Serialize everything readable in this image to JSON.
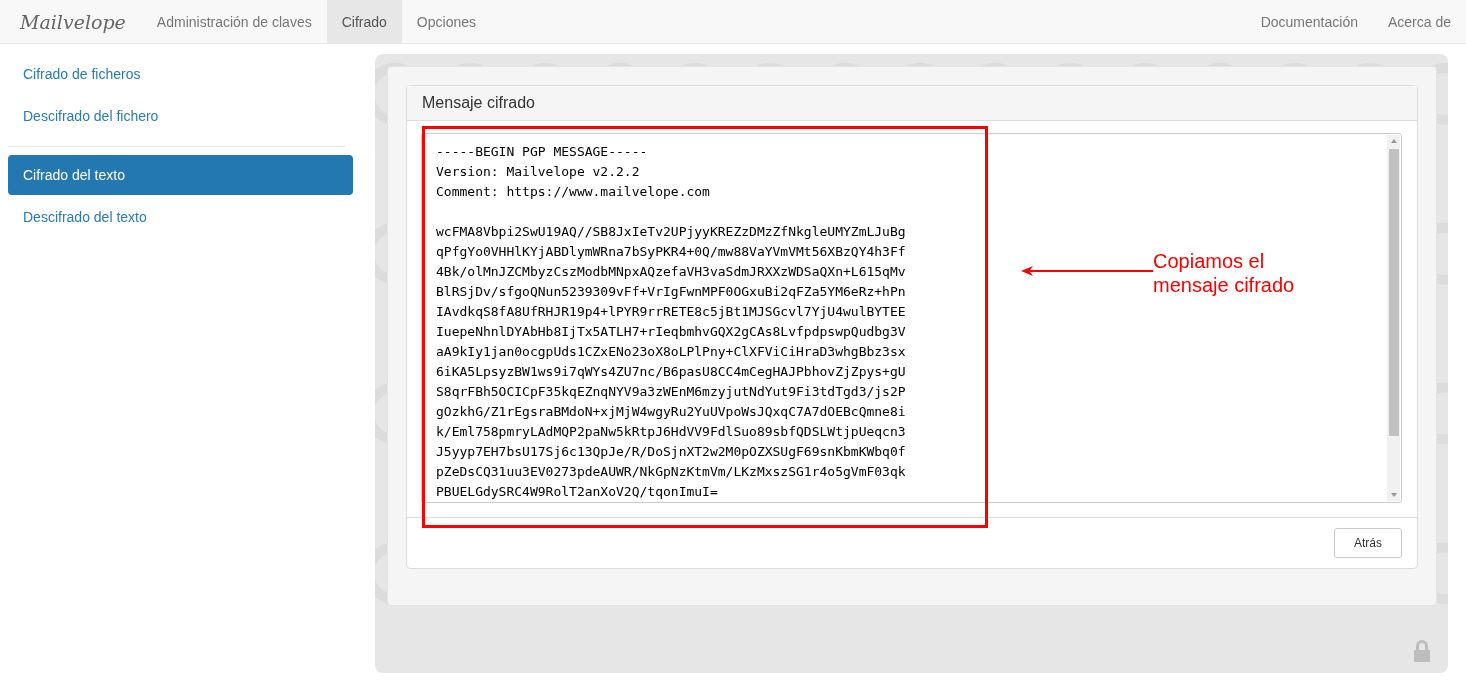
{
  "navbar": {
    "brand": "Mailvelope",
    "items": [
      {
        "label": "Administración de claves",
        "selected": false
      },
      {
        "label": "Cifrado",
        "selected": true
      },
      {
        "label": "Opciones",
        "selected": false
      }
    ],
    "right_items": [
      "Documentación",
      "Acerca de"
    ]
  },
  "sidebar": {
    "sections": [
      {
        "items": [
          {
            "label": "Cifrado de ficheros",
            "selected": false
          },
          {
            "label": "Descifrado del fichero",
            "selected": false
          }
        ]
      },
      {
        "items": [
          {
            "label": "Cifrado del texto",
            "selected": true
          },
          {
            "label": "Descifrado del texto",
            "selected": false
          }
        ]
      }
    ]
  },
  "panel": {
    "title": "Mensaje cifrado",
    "message": "-----BEGIN PGP MESSAGE-----\nVersion: Mailvelope v2.2.2\nComment: https://www.mailvelope.com\n\nwcFMA8Vbpi2SwU19AQ//SB8JxIeTv2UPjyyKREZzDMzZfNkgleUMYZmLJuBg\nqPfgYo0VHHlKYjABDlymWRna7bSyPKR4+0Q/mw88VaYVmVMt56XBzQY4h3Ff\n4Bk/olMnJZCMbyzCszModbMNpxAQzefaVH3vaSdmJRXXzWDSaQXn+L615qMv\nBlRSjDv/sfgoQNun5239309vFf+VrIgFwnMPF0OGxuBi2qFZa5YM6eRz+hPn\nIAvdkqS8fA8UfRHJR19p4+lPYR9rrRETE8c5jBt1MJSGcvl7YjU4wulBYTEE\nIuepeNhnlDYAbHb8IjTx5ATLH7+rIeqbmhvGQX2gCAs8LvfpdpswpQudbg3V\naA9kIy1jan0ocgpUds1CZxENo23oX8oLPlPny+ClXFViCiHraD3whgBbz3sx\n6iKA5LpsyzBW1ws9i7qWYs4ZU7nc/B6pasU8CC4mCegHAJPbhovZjZpys+gU\nS8qrFBh5OCICpF35kqEZnqNYV9a3zWEnM6mzyjutNdYut9Fi3tdTgd3/js2P\ngOzkhG/Z1rEgsraBMdoN+xjMjW4wgyRu2YuUVpoWsJQxqC7A7dOEBcQmne8i\nk/Eml758pmryLAdMQP2paNw5kRtpJ6HdVV9FdlSuo89sbfQDSLWtjpUeqcn3\nJ5yyp7EH7bsU17Sj6c13QpJe/R/DoSjnXT2w2M0pOZXSUgF69snKbmKWbq0f\npZeDsCQ31uu3EV0273pdeAUWR/NkGpNzKtmVm/LKzMxszSG1r4o5gVmF03qk\nPBUELGdySRC4W9RolT2anXoV2Q/tqonImuI=",
    "button": "Atrás"
  },
  "annotation": {
    "text": "Copiamos el mensaje cifrado"
  }
}
